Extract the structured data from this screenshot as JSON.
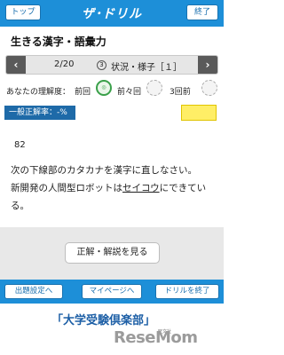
{
  "header": {
    "top_button": "トップ",
    "title": "ザ･ドリル",
    "end_button": "終了"
  },
  "unit_title": "生きる漢字・語彙力",
  "nav": {
    "prev_icon": "chevron-left-icon",
    "page": "2/20",
    "number": "3",
    "topic": "状況・様子［１］",
    "next_icon": "chevron-right-icon"
  },
  "understanding": {
    "label": "あなたの理解度：",
    "items": [
      "前回",
      "前々回",
      "3回前"
    ]
  },
  "accuracy_label": "一般正解率：-%",
  "question": {
    "number": "82",
    "instruction": "次の下線部のカタカナを漢字に直しなさい。",
    "line_before": "新開発の人間型ロボットは",
    "underlined": "セイコウ",
    "line_after": "にできてい",
    "line_end": "る。"
  },
  "answer_button": "正解・解説を見る",
  "footer": {
    "settings": "出題設定へ",
    "mypage": "マイページへ",
    "end_drill": "ドリルを終了"
  },
  "brand": "「大学受験倶楽部」",
  "brand_small": "旺文社",
  "watermark": "ReseMom",
  "colors": {
    "header_blue": "#1d8fd8",
    "badge_blue": "#1e6aa8",
    "yellow": "#ffee66",
    "gray_area": "#e8e8e8"
  }
}
